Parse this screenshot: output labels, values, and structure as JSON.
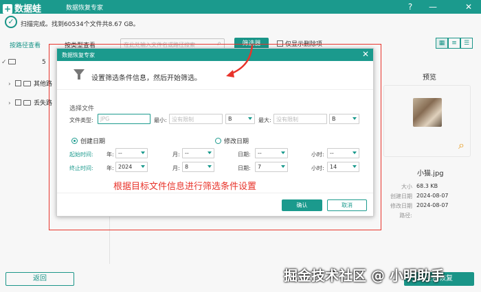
{
  "app": {
    "logo_text": "数据蛙",
    "title": "数据恢复专家"
  },
  "window_controls": {
    "help": "?",
    "minimize": "—",
    "close": "✕"
  },
  "status": {
    "text": "扫描完成。找到60534个文件共8.67 GB。"
  },
  "toolbar": {
    "tab_path": "按路径查看",
    "tab_type": "按类型查看",
    "search_placeholder": "在此处输入文件名或路径搜索",
    "filter_label": "筛选器",
    "only_deleted_label": "仅显示删除项"
  },
  "tree": {
    "drive_label": "5",
    "items": [
      {
        "label": "其他路"
      },
      {
        "label": "丢失路"
      }
    ]
  },
  "preview": {
    "title": "预览",
    "file_name": "小猫.jpg",
    "meta": [
      {
        "key": "大小",
        "value": "68.3 KB"
      },
      {
        "key": "创建日期",
        "value": "2024-08-07"
      },
      {
        "key": "修改日期",
        "value": "2024-08-07"
      },
      {
        "key": "路径:",
        "value": ""
      }
    ]
  },
  "dialog": {
    "title": "数据恢复专家",
    "close": "✕",
    "message": "设置筛选条件信息，然后开始筛选。",
    "section_label": "选择文件",
    "file_type_label": "文件类型:",
    "file_type_placeholder": "JPG",
    "min_label": "最小:",
    "min_placeholder": "没有限制",
    "min_unit": "B",
    "max_label": "最大:",
    "max_placeholder": "没有限制",
    "max_unit": "B",
    "radio_created": "创建日期",
    "radio_modified": "修改日期",
    "start_label": "起始时间:",
    "end_label": "终止时间:",
    "year_label": "年:",
    "month_label": "月:",
    "day_label": "日期:",
    "hour_label": "小时:",
    "start": {
      "year": "--",
      "month": "--",
      "day": "--",
      "hour": "--"
    },
    "end": {
      "year": "2024",
      "month": "8",
      "day": "7",
      "hour": "14"
    },
    "ok": "确认",
    "cancel": "取消"
  },
  "annotation": "根据目标文件信息进行筛选条件设置",
  "footer": {
    "back": "返回",
    "recover": "全部恢复"
  },
  "watermark": "掘金技术社区 @ 小明助手",
  "colors": {
    "accent": "#1b9a8d",
    "annotation": "#e8332a"
  }
}
